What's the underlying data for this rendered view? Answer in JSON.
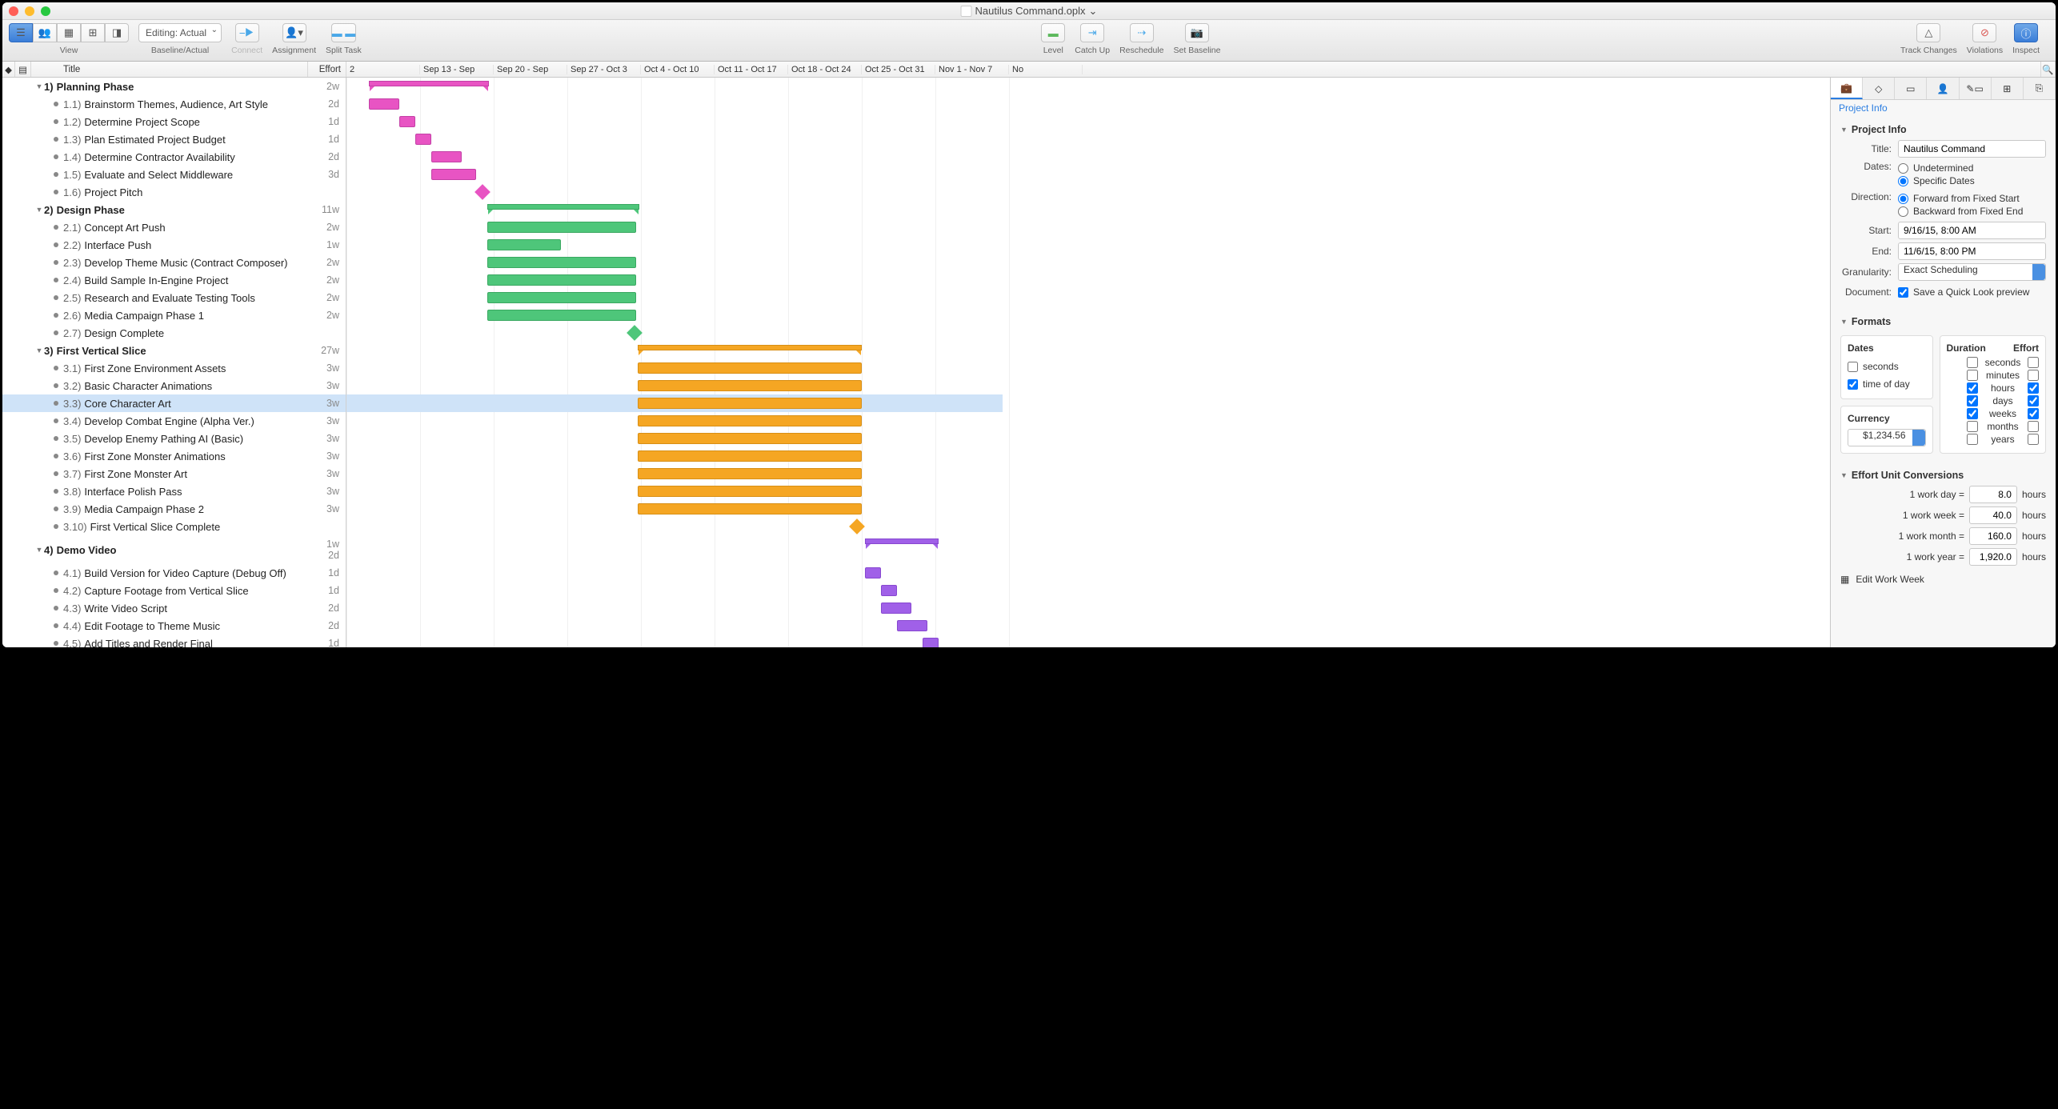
{
  "window": {
    "title": "Nautilus Command.oplx",
    "title_suffix": " ⌄"
  },
  "toolbar": {
    "view": "View",
    "baseline_actual_select": "Editing: Actual",
    "baseline_actual_label": "Baseline/Actual",
    "connect": "Connect",
    "assignment": "Assignment",
    "split_task": "Split Task",
    "level": "Level",
    "catch_up": "Catch Up",
    "reschedule": "Reschedule",
    "set_baseline": "Set Baseline",
    "track_changes": "Track Changes",
    "violations": "Violations",
    "inspect": "Inspect"
  },
  "columns": {
    "title": "Title",
    "effort": "Effort"
  },
  "timeline_headers": [
    "2",
    "Sep 13 - Sep",
    "Sep 20 - Sep",
    "Sep 27 - Oct 3",
    "Oct 4 - Oct 10",
    "Oct 11 - Oct 17",
    "Oct 18 - Oct 24",
    "Oct 25 - Oct 31",
    "Nov 1 - Nov 7",
    "No"
  ],
  "tasks": [
    {
      "n": "1)",
      "t": "Planning Phase",
      "e": "2w",
      "g": true,
      "lvl": 0,
      "c": "pink",
      "bar": [
        28,
        150
      ],
      "grp": true
    },
    {
      "n": "1.1)",
      "t": "Brainstorm Themes, Audience, Art Style",
      "e": "2d",
      "lvl": 1,
      "c": "pink",
      "bar": [
        28,
        38
      ]
    },
    {
      "n": "1.2)",
      "t": "Determine Project Scope",
      "e": "1d",
      "lvl": 1,
      "c": "pink",
      "bar": [
        66,
        20
      ]
    },
    {
      "n": "1.3)",
      "t": "Plan Estimated Project Budget",
      "e": "1d",
      "lvl": 1,
      "c": "pink",
      "bar": [
        86,
        20
      ]
    },
    {
      "n": "1.4)",
      "t": "Determine Contractor Availability",
      "e": "2d",
      "lvl": 1,
      "c": "pink",
      "bar": [
        106,
        38
      ]
    },
    {
      "n": "1.5)",
      "t": "Evaluate and Select Middleware",
      "e": "3d",
      "lvl": 1,
      "c": "pink",
      "bar": [
        106,
        56
      ]
    },
    {
      "n": "1.6)",
      "t": "Project Pitch",
      "e": "",
      "lvl": 1,
      "c": "pink",
      "ms": 170
    },
    {
      "n": "2)",
      "t": "Design Phase",
      "e": "11w",
      "g": true,
      "lvl": 0,
      "c": "green",
      "bar": [
        176,
        190
      ],
      "grp": true
    },
    {
      "n": "2.1)",
      "t": "Concept Art Push",
      "e": "2w",
      "lvl": 1,
      "c": "green",
      "bar": [
        176,
        186
      ]
    },
    {
      "n": "2.2)",
      "t": "Interface Push",
      "e": "1w",
      "lvl": 1,
      "c": "green",
      "bar": [
        176,
        92
      ]
    },
    {
      "n": "2.3)",
      "t": "Develop Theme Music (Contract Composer)",
      "e": "2w",
      "lvl": 1,
      "c": "green",
      "bar": [
        176,
        186
      ]
    },
    {
      "n": "2.4)",
      "t": "Build Sample In-Engine Project",
      "e": "2w",
      "lvl": 1,
      "c": "green",
      "bar": [
        176,
        186
      ]
    },
    {
      "n": "2.5)",
      "t": "Research and Evaluate Testing Tools",
      "e": "2w",
      "lvl": 1,
      "c": "green",
      "bar": [
        176,
        186
      ]
    },
    {
      "n": "2.6)",
      "t": "Media Campaign Phase 1",
      "e": "2w",
      "lvl": 1,
      "c": "green",
      "bar": [
        176,
        186
      ]
    },
    {
      "n": "2.7)",
      "t": "Design Complete",
      "e": "",
      "lvl": 1,
      "c": "green",
      "ms": 360
    },
    {
      "n": "3)",
      "t": "First Vertical Slice",
      "e": "27w",
      "g": true,
      "lvl": 0,
      "c": "orange",
      "bar": [
        364,
        280
      ],
      "grp": true
    },
    {
      "n": "3.1)",
      "t": "First Zone Environment Assets",
      "e": "3w",
      "lvl": 1,
      "c": "orange",
      "bar": [
        364,
        280
      ]
    },
    {
      "n": "3.2)",
      "t": "Basic Character Animations",
      "e": "3w",
      "lvl": 1,
      "c": "orange",
      "bar": [
        364,
        280
      ]
    },
    {
      "n": "3.3)",
      "t": "Core Character Art",
      "e": "3w",
      "lvl": 1,
      "c": "orange",
      "bar": [
        364,
        280
      ],
      "sel": true
    },
    {
      "n": "3.4)",
      "t": "Develop Combat Engine (Alpha Ver.)",
      "e": "3w",
      "lvl": 1,
      "c": "orange",
      "bar": [
        364,
        280
      ]
    },
    {
      "n": "3.5)",
      "t": "Develop Enemy Pathing AI (Basic)",
      "e": "3w",
      "lvl": 1,
      "c": "orange",
      "bar": [
        364,
        280
      ]
    },
    {
      "n": "3.6)",
      "t": "First Zone Monster Animations",
      "e": "3w",
      "lvl": 1,
      "c": "orange",
      "bar": [
        364,
        280
      ]
    },
    {
      "n": "3.7)",
      "t": "First Zone Monster Art",
      "e": "3w",
      "lvl": 1,
      "c": "orange",
      "bar": [
        364,
        280
      ]
    },
    {
      "n": "3.8)",
      "t": "Interface Polish Pass",
      "e": "3w",
      "lvl": 1,
      "c": "orange",
      "bar": [
        364,
        280
      ]
    },
    {
      "n": "3.9)",
      "t": "Media Campaign Phase 2",
      "e": "3w",
      "lvl": 1,
      "c": "orange",
      "bar": [
        364,
        280
      ]
    },
    {
      "n": "3.10)",
      "t": "First Vertical Slice Complete",
      "e": "",
      "lvl": 1,
      "c": "orange",
      "ms": 638
    },
    {
      "n": "4)",
      "t": "Demo Video",
      "e": "1w\n2d",
      "g": true,
      "lvl": 0,
      "c": "purple",
      "bar": [
        648,
        92
      ],
      "grp": true,
      "tall": true
    },
    {
      "n": "4.1)",
      "t": "Build Version for Video Capture (Debug Off)",
      "e": "1d",
      "lvl": 1,
      "c": "purple",
      "bar": [
        648,
        20
      ]
    },
    {
      "n": "4.2)",
      "t": "Capture Footage from Vertical Slice",
      "e": "1d",
      "lvl": 1,
      "c": "purple",
      "bar": [
        668,
        20
      ]
    },
    {
      "n": "4.3)",
      "t": "Write Video Script",
      "e": "2d",
      "lvl": 1,
      "c": "purple",
      "bar": [
        668,
        38
      ]
    },
    {
      "n": "4.4)",
      "t": "Edit Footage to Theme Music",
      "e": "2d",
      "lvl": 1,
      "c": "purple",
      "bar": [
        688,
        38
      ]
    },
    {
      "n": "4.5)",
      "t": "Add Titles and Render Final",
      "e": "1d",
      "lvl": 1,
      "c": "purple",
      "bar": [
        720,
        20
      ]
    }
  ],
  "inspector": {
    "header": "Project Info",
    "section_project_info": "Project Info",
    "title_label": "Title:",
    "title_value": "Nautilus Command",
    "dates_label": "Dates:",
    "dates_undetermined": "Undetermined",
    "dates_specific": "Specific Dates",
    "direction_label": "Direction:",
    "direction_forward": "Forward from Fixed Start",
    "direction_backward": "Backward from Fixed End",
    "start_label": "Start:",
    "start_value": "9/16/15, 8:00 AM",
    "end_label": "End:",
    "end_value": "11/6/15, 8:00 PM",
    "granularity_label": "Granularity:",
    "granularity_value": "Exact Scheduling",
    "document_label": "Document:",
    "document_quick_look": "Save a Quick Look preview",
    "section_formats": "Formats",
    "formats_dates": "Dates",
    "formats_dates_seconds": "seconds",
    "formats_dates_tod": "time of day",
    "formats_currency": "Currency",
    "currency_value": "$1,234.56",
    "formats_duration": "Duration",
    "formats_effort": "Effort",
    "units": {
      "seconds": "seconds",
      "minutes": "minutes",
      "hours": "hours",
      "days": "days",
      "weeks": "weeks",
      "months": "months",
      "years": "years"
    },
    "section_conversions": "Effort Unit Conversions",
    "conv": {
      "day_label": "1 work day =",
      "day_val": "8.0",
      "day_unit": "hours",
      "week_label": "1 work week =",
      "week_val": "40.0",
      "week_unit": "hours",
      "month_label": "1 work month =",
      "month_val": "160.0",
      "month_unit": "hours",
      "year_label": "1 work year =",
      "year_val": "1,920.0",
      "year_unit": "hours"
    },
    "edit_work_week": "Edit Work Week"
  }
}
